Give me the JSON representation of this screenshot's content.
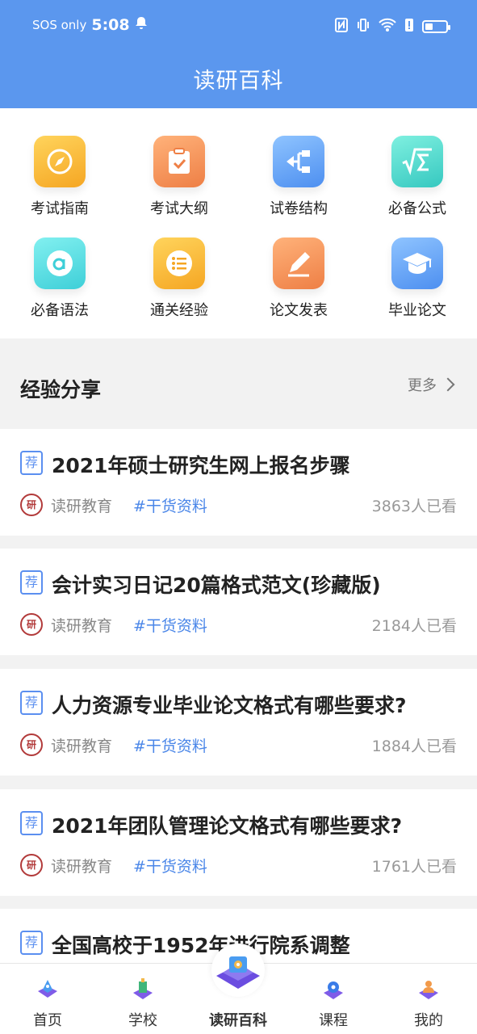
{
  "status": {
    "sos": "SOS only",
    "time": "5:08",
    "icons": [
      "bell-icon",
      "nfc-icon",
      "vibrate-icon",
      "wifi-icon",
      "alert-icon",
      "battery-icon"
    ]
  },
  "header": {
    "title": "读研百科"
  },
  "grid": [
    {
      "label": "考试指南",
      "icon": "compass-icon",
      "color": "yellow"
    },
    {
      "label": "考试大纲",
      "icon": "clipboard-icon",
      "color": "orange"
    },
    {
      "label": "试卷结构",
      "icon": "structure-icon",
      "color": "blue"
    },
    {
      "label": "必备公式",
      "icon": "formula-icon",
      "color": "teal"
    },
    {
      "label": "必备语法",
      "icon": "letter-a-icon",
      "color": "cyan"
    },
    {
      "label": "通关经验",
      "icon": "list-icon",
      "color": "yellow"
    },
    {
      "label": "论文发表",
      "icon": "pencil-icon",
      "color": "orange"
    },
    {
      "label": "毕业论文",
      "icon": "graduation-cap-icon",
      "color": "blue"
    }
  ],
  "section": {
    "title": "经验分享",
    "more": "更多"
  },
  "articles": [
    {
      "badge": "荐",
      "title": "2021年硕士研究生网上报名步骤",
      "author": "读研教育",
      "tag": "#干货资料",
      "views": "3863人已看"
    },
    {
      "badge": "荐",
      "title": "会计实习日记20篇格式范文(珍藏版)",
      "author": "读研教育",
      "tag": "#干货资料",
      "views": "2184人已看"
    },
    {
      "badge": "荐",
      "title": "人力资源专业毕业论文格式有哪些要求?",
      "author": "读研教育",
      "tag": "#干货资料",
      "views": "1884人已看"
    },
    {
      "badge": "荐",
      "title": "2021年团队管理论文格式有哪些要求?",
      "author": "读研教育",
      "tag": "#干货资料",
      "views": "1761人已看"
    },
    {
      "badge": "荐",
      "title": "全国高校于1952年进行院系调整"
    }
  ],
  "nav": [
    {
      "label": "首页",
      "icon": "home-icon"
    },
    {
      "label": "学校",
      "icon": "school-icon"
    },
    {
      "label": "读研百科",
      "icon": "encyclopedia-icon",
      "active": true
    },
    {
      "label": "课程",
      "icon": "course-icon"
    },
    {
      "label": "我的",
      "icon": "profile-icon"
    }
  ]
}
